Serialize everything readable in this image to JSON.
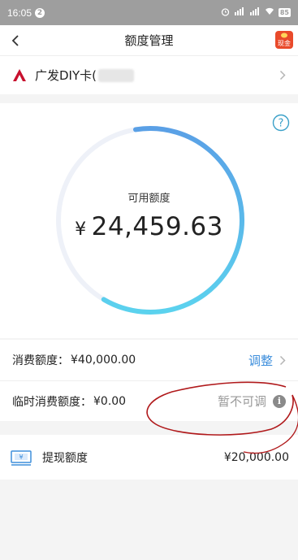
{
  "status_bar": {
    "time": "16:05",
    "notification_count": "2",
    "battery": "85"
  },
  "nav": {
    "title": "额度管理",
    "badge_label": "现金"
  },
  "card": {
    "name": "广发DIY卡(",
    "brand_color": "#c8102e"
  },
  "limit": {
    "label": "可用额度",
    "currency": "¥",
    "amount": "24,459.63",
    "ring_fraction": 0.61,
    "ring_color_start": "#5aa0e6",
    "ring_color_end": "#5bd2ee",
    "ring_track_color": "#eef1f8"
  },
  "rows": {
    "consumption": {
      "label": "消费额度：",
      "value": "¥40,000.00",
      "action": "调整"
    },
    "temporary": {
      "label": "临时消费额度：",
      "value": "¥0.00",
      "status": "暂不可调"
    }
  },
  "cash": {
    "label": "提现额度",
    "value": "¥20,000.00"
  },
  "colors": {
    "accent": "#3f8fdc",
    "annotation": "#b0191b"
  }
}
